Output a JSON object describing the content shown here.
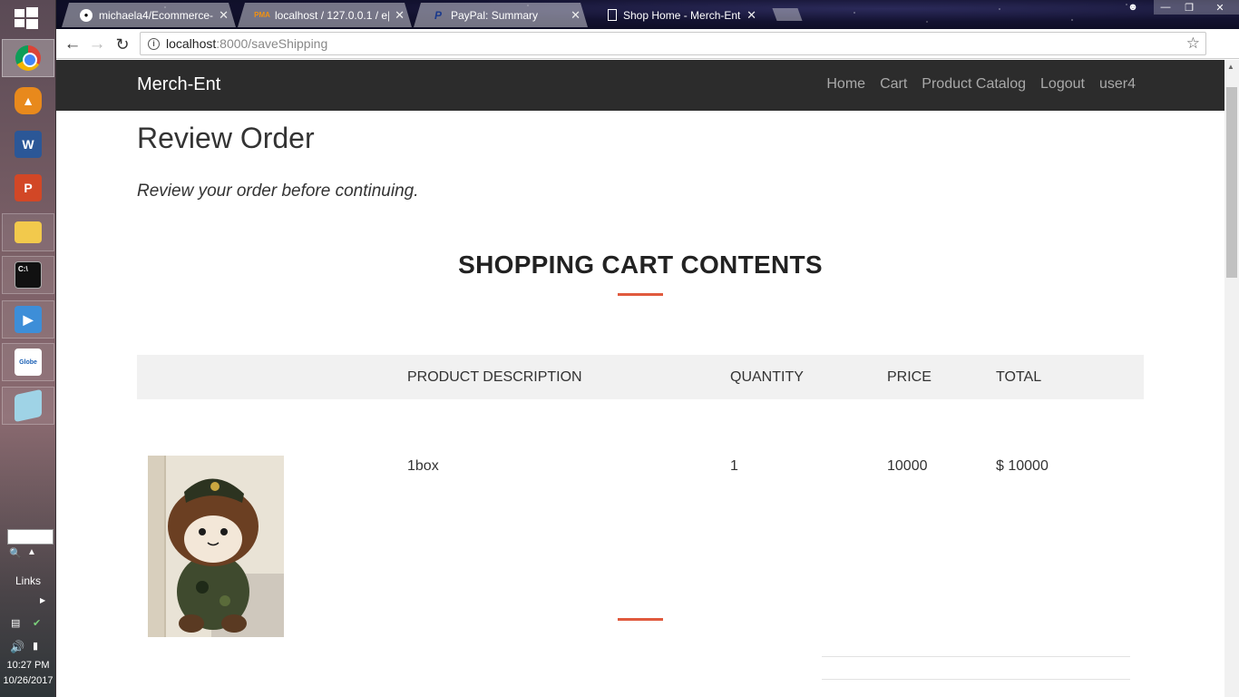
{
  "taskbar": {
    "links_label": "Links",
    "time": "10:27 PM",
    "date": "10/26/2017",
    "apps": [
      "chrome-icon",
      "backpack-icon",
      "word-icon",
      "powerpoint-icon",
      "file-explorer-icon",
      "command-prompt-icon",
      "media-player-icon",
      "globe-broadband-icon",
      "notepad-icon"
    ]
  },
  "browser": {
    "tabs": [
      {
        "title": "michaela4/Ecommerce-",
        "favicon": "github-icon"
      },
      {
        "title": "localhost / 127.0.0.1 / e|",
        "favicon": "phpmyadmin-icon"
      },
      {
        "title": "PayPal: Summary",
        "favicon": "paypal-icon"
      },
      {
        "title": "Shop Home - Merch-Ent",
        "favicon": "page-icon"
      }
    ],
    "url_host": "localhost",
    "url_rest": ":8000/saveShipping"
  },
  "site": {
    "brand": "Merch-Ent",
    "nav": [
      "Home",
      "Cart",
      "Product Catalog",
      "Logout",
      "user4"
    ]
  },
  "page": {
    "title": "Review Order",
    "subtitle": "Review your order before continuing.",
    "section_heading": "SHOPPING CART CONTENTS"
  },
  "cart": {
    "columns": [
      "PRODUCT DESCRIPTION",
      "QUANTITY",
      "PRICE",
      "TOTAL"
    ],
    "items": [
      {
        "description": "1box",
        "quantity": "1",
        "price": "10000",
        "total": "$ 10000"
      }
    ]
  },
  "colors": {
    "navbar_bg": "#2c2c2c",
    "accent_rule": "#e05a3e",
    "table_header_bg": "#f1f1f1"
  }
}
